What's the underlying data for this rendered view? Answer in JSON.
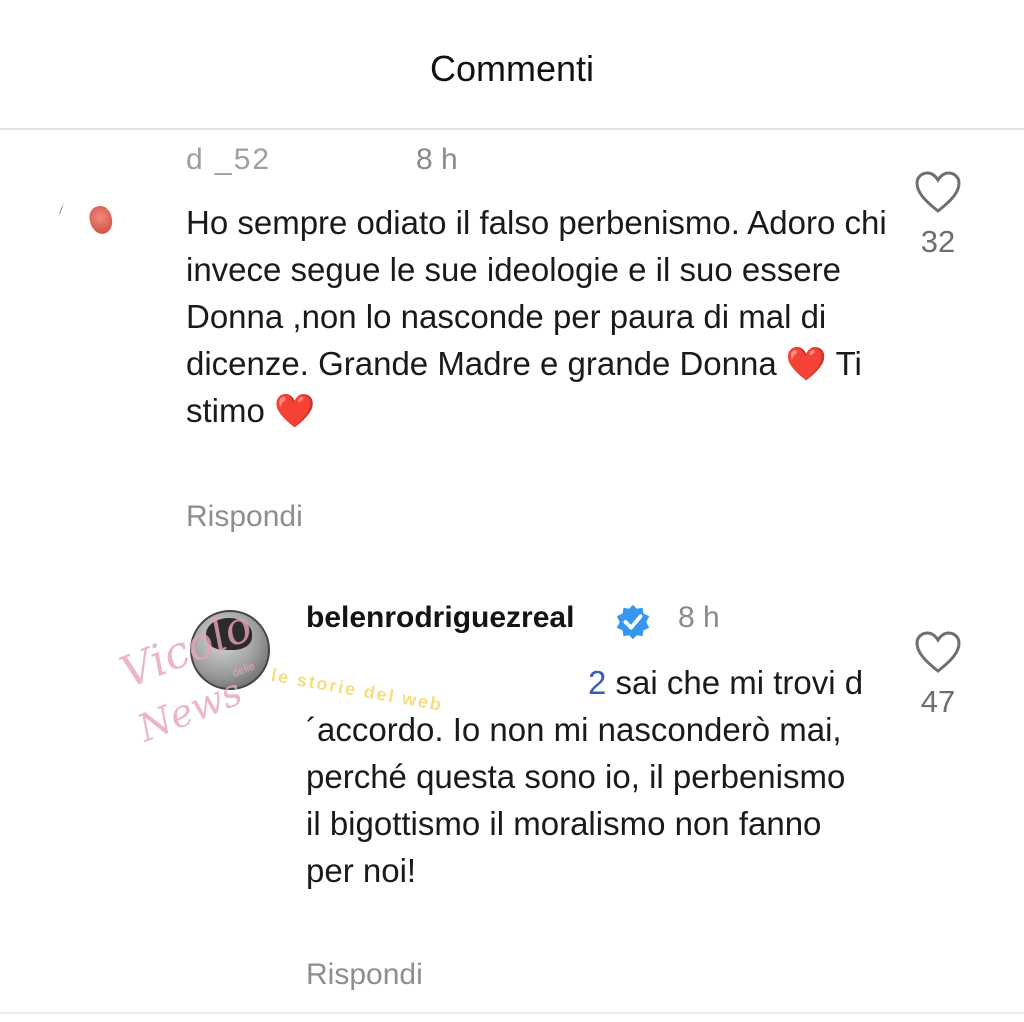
{
  "header": {
    "title": "Commenti"
  },
  "comments": [
    {
      "username": "d              _52",
      "time": "8 h",
      "text": "Ho sempre odiato il falso perbenismo. Adoro chi invece segue le sue ideologie e il suo essere Donna ,non lo nasconde per paura di mal di dicenze. Grande Madre e grande Donna",
      "text_after_heart": "Ti stimo",
      "reply_label": "Rispondi",
      "likes": "32"
    },
    {
      "username": "belenrodriguezreal",
      "verified": true,
      "time": "8 h",
      "text": "sai che mi trovi d´accordo. Io non mi nasconderò mai, perché questa sono io, il perbenismo il bigottismo il moralismo non fanno per noi!",
      "mention_tail": "2",
      "reply_label": "Rispondi",
      "likes": "47"
    }
  ],
  "watermark": {
    "line1": "Vicolo",
    "line2": "News",
    "small": "delle",
    "banner": "le storie del web"
  },
  "colors": {
    "heart_emoji": "#e0242f",
    "verified": "#3797f0"
  },
  "icons": {
    "like": "heart-outline-icon",
    "verified": "verified-badge-icon"
  }
}
